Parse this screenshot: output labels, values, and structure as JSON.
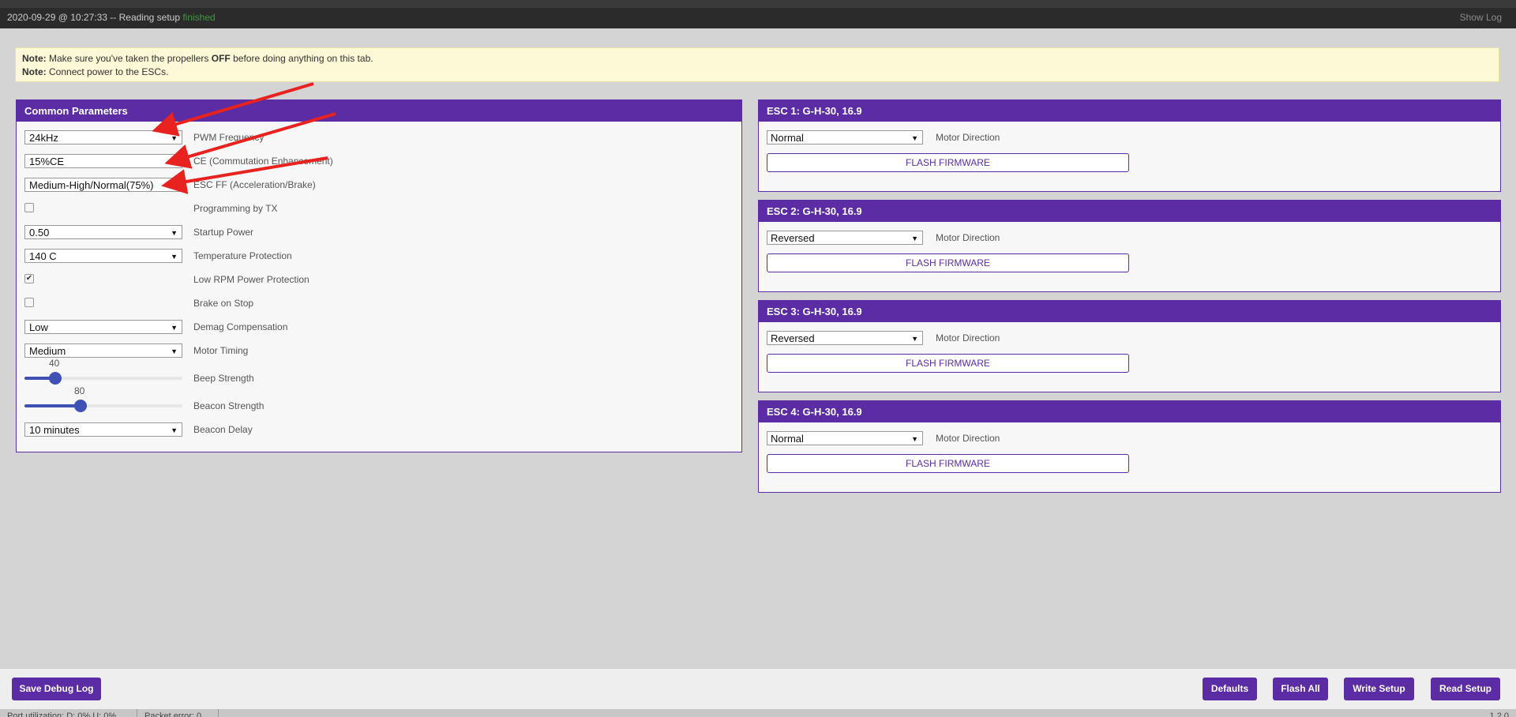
{
  "log": {
    "prefix": "2020-09-29 @ 10:27:33 -- Reading setup",
    "status": "finished",
    "show_log": "Show Log"
  },
  "note": {
    "line1_label": "Note:",
    "line1_pre": "Make sure you've taken the propellers",
    "line1_bold": "OFF",
    "line1_post": "before doing anything on this tab.",
    "line2_label": "Note:",
    "line2_text": "Connect power to the ESCs."
  },
  "common": {
    "title": "Common Parameters",
    "pwm_frequency": {
      "value": "24kHz",
      "label": "PWM Frequency"
    },
    "ce": {
      "value": "15%CE",
      "label": "CE (Commutation Enhancement)"
    },
    "esc_ff": {
      "value": "Medium-High/Normal(75%)",
      "label": "ESC FF (Acceleration/Brake)"
    },
    "programming_by_tx": {
      "checked": false,
      "label": "Programming by TX"
    },
    "startup_power": {
      "value": "0.50",
      "label": "Startup Power"
    },
    "temperature_protection": {
      "value": "140 C",
      "label": "Temperature Protection"
    },
    "low_rpm_power_protection": {
      "checked": true,
      "label": "Low RPM Power Protection"
    },
    "brake_on_stop": {
      "checked": false,
      "label": "Brake on Stop"
    },
    "demag_compensation": {
      "value": "Low",
      "label": "Demag Compensation"
    },
    "motor_timing": {
      "value": "Medium",
      "label": "Motor Timing"
    },
    "beep_strength": {
      "value": "40",
      "fraction": 0.157,
      "label": "Beep Strength"
    },
    "beacon_strength": {
      "value": "80",
      "fraction": 0.314,
      "label": "Beacon Strength"
    },
    "beacon_delay": {
      "value": "10 minutes",
      "label": "Beacon Delay"
    }
  },
  "escs": [
    {
      "title": "ESC 1: G-H-30, 16.9",
      "direction": "Normal",
      "direction_label": "Motor Direction",
      "flash_label": "FLASH FIRMWARE"
    },
    {
      "title": "ESC 2: G-H-30, 16.9",
      "direction": "Reversed",
      "direction_label": "Motor Direction",
      "flash_label": "FLASH FIRMWARE"
    },
    {
      "title": "ESC 3: G-H-30, 16.9",
      "direction": "Reversed",
      "direction_label": "Motor Direction",
      "flash_label": "FLASH FIRMWARE"
    },
    {
      "title": "ESC 4: G-H-30, 16.9",
      "direction": "Normal",
      "direction_label": "Motor Direction",
      "flash_label": "FLASH FIRMWARE"
    }
  ],
  "buttons": {
    "save_debug_log": "Save Debug Log",
    "defaults": "Defaults",
    "flash_all": "Flash All",
    "write_setup": "Write Setup",
    "read_setup": "Read Setup"
  },
  "status": {
    "port_utilization": "Port utilization: D: 0% U: 0%",
    "packet_error": "Packet error: 0",
    "version": "1.2.0"
  },
  "colors": {
    "accent": "#5b2ca3",
    "slider": "#3f51b5",
    "annotation_arrow": "#e8231f"
  }
}
